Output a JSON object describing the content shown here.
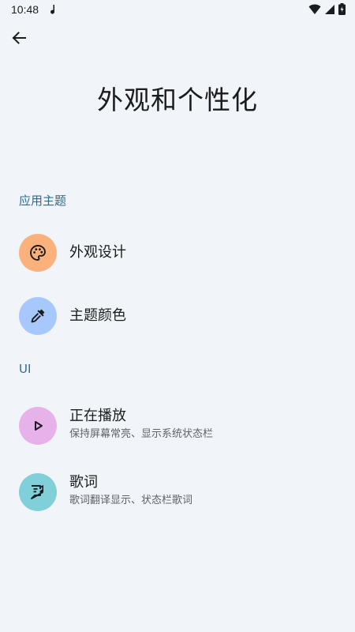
{
  "status_bar": {
    "time": "10:48"
  },
  "page": {
    "title": "外观和个性化"
  },
  "sections": [
    {
      "header": "应用主题",
      "items": [
        {
          "title": "外观设计",
          "subtitle": "",
          "icon": "palette-icon",
          "color": "#fbb17c"
        },
        {
          "title": "主题颜色",
          "subtitle": "",
          "icon": "eyedropper-icon",
          "color": "#a6c8fb"
        }
      ]
    },
    {
      "header": "UI",
      "items": [
        {
          "title": "正在播放",
          "subtitle": "保持屏幕常亮、显示系统状态栏",
          "icon": "play-icon",
          "color": "#e7b2ea"
        },
        {
          "title": "歌词",
          "subtitle": "歌词翻译显示、状态栏歌词",
          "icon": "lyrics-icon",
          "color": "#80cfd9"
        }
      ]
    }
  ],
  "colors": {
    "background": "#f1f4f9",
    "accent": "#2f6c8f"
  }
}
